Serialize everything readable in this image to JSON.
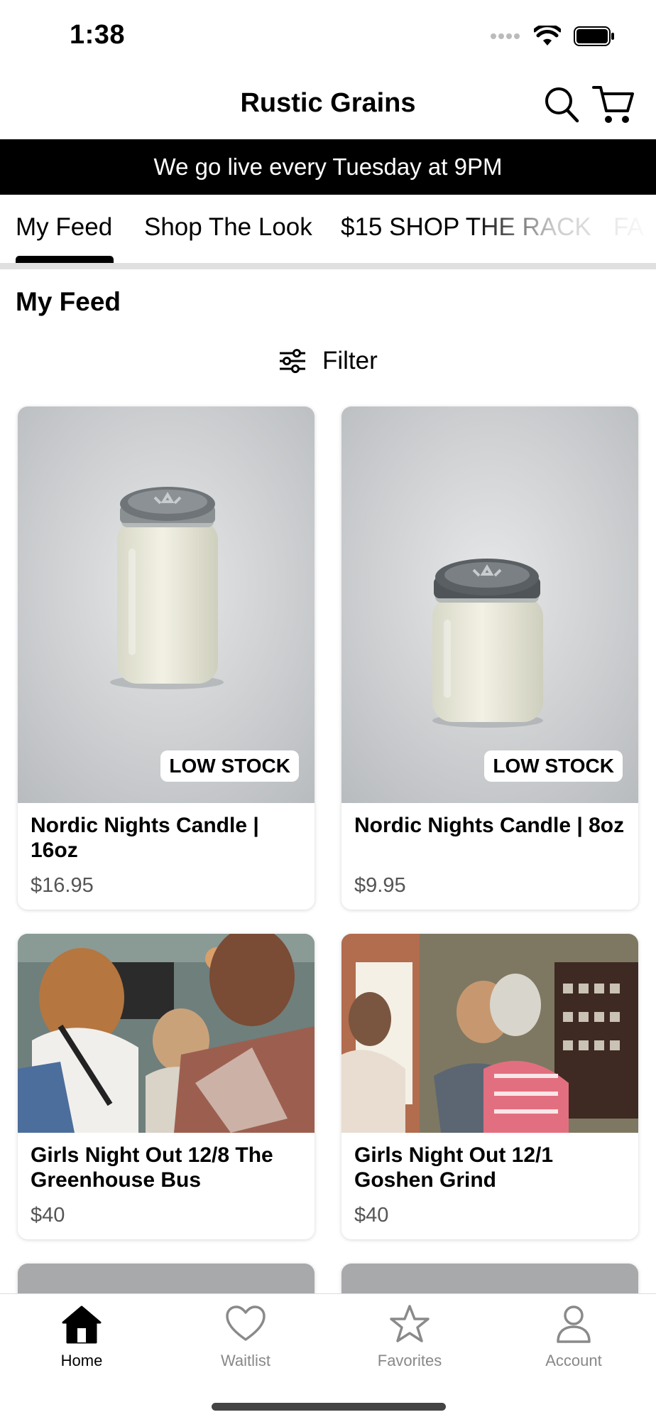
{
  "status": {
    "time": "1:38"
  },
  "header": {
    "title": "Rustic Grains"
  },
  "banner": {
    "text": "We go live every Tuesday at 9PM"
  },
  "tabs": [
    {
      "label": "My Feed"
    },
    {
      "label": "Shop The Look"
    },
    {
      "label": "$15 SHOP THE RACK"
    },
    {
      "label": "FA"
    }
  ],
  "feed": {
    "title": "My Feed",
    "filter_label": "Filter",
    "products": [
      {
        "name": "Nordic Nights Candle | 16oz",
        "price": "$16.95",
        "badge": "LOW STOCK",
        "image": "candle-16oz-photo"
      },
      {
        "name": "Nordic Nights Candle | 8oz",
        "price": "$9.95",
        "badge": "LOW STOCK",
        "image": "candle-8oz-photo"
      },
      {
        "name": "Girls Night Out 12/8 The Greenhouse Bus",
        "price": "$40",
        "image": "event-crowd-photo"
      },
      {
        "name": "Girls Night Out 12/1 Goshen Grind",
        "price": "$40",
        "image": "event-women-hugging-photo"
      }
    ]
  },
  "bottom_nav": [
    {
      "label": "Home",
      "icon": "home-icon"
    },
    {
      "label": "Waitlist",
      "icon": "heart-icon"
    },
    {
      "label": "Favorites",
      "icon": "star-icon"
    },
    {
      "label": "Account",
      "icon": "person-icon"
    }
  ],
  "colors": {
    "banner_bg": "#000000",
    "accent": "#000000",
    "inactive": "#888888"
  }
}
